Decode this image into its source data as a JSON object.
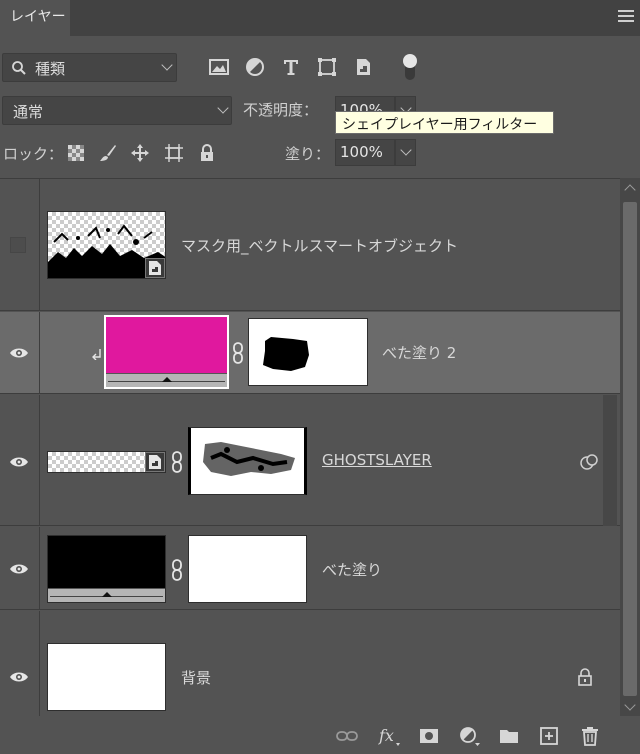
{
  "panel": {
    "tab_label": "レイヤー",
    "menu_icon": "hamburger-menu-icon"
  },
  "filter": {
    "kind_label": "種類",
    "icons": [
      "image-filter-icon",
      "adjustment-filter-icon",
      "type-filter-icon",
      "shape-filter-icon",
      "smart-object-filter-icon"
    ],
    "toggle_state": "on"
  },
  "blend": {
    "mode": "通常",
    "opacity_label": "不透明度：",
    "opacity_value": "100%",
    "tooltip": "シェイプレイヤー用フィルター"
  },
  "lock": {
    "label": "ロック：",
    "icons": [
      "lock-transparent-pixels-icon",
      "lock-image-pixels-icon",
      "lock-position-icon",
      "lock-artboard-icon",
      "lock-all-icon"
    ],
    "fill_label": "塗り：",
    "fill_value": "100%"
  },
  "layers": [
    {
      "name": "マスク用_ベクトルスマートオブジェクト",
      "visible": false,
      "type": "smart-object"
    },
    {
      "name": "べた塗り 2",
      "visible": true,
      "type": "solid-fill",
      "color": "#e0189e",
      "clipped": true,
      "selected": true
    },
    {
      "name": "GHOSTSLAYER",
      "visible": true,
      "type": "smart-object-with-mask",
      "linked": true
    },
    {
      "name": "べた塗り",
      "visible": true,
      "type": "solid-fill",
      "color": "#000000"
    },
    {
      "name": "背景",
      "visible": true,
      "type": "background",
      "locked": true
    }
  ],
  "footer_icons": [
    "link-layers-icon",
    "fx-icon",
    "add-mask-icon",
    "new-adjustment-icon",
    "new-group-icon",
    "new-layer-icon",
    "delete-layer-icon"
  ]
}
